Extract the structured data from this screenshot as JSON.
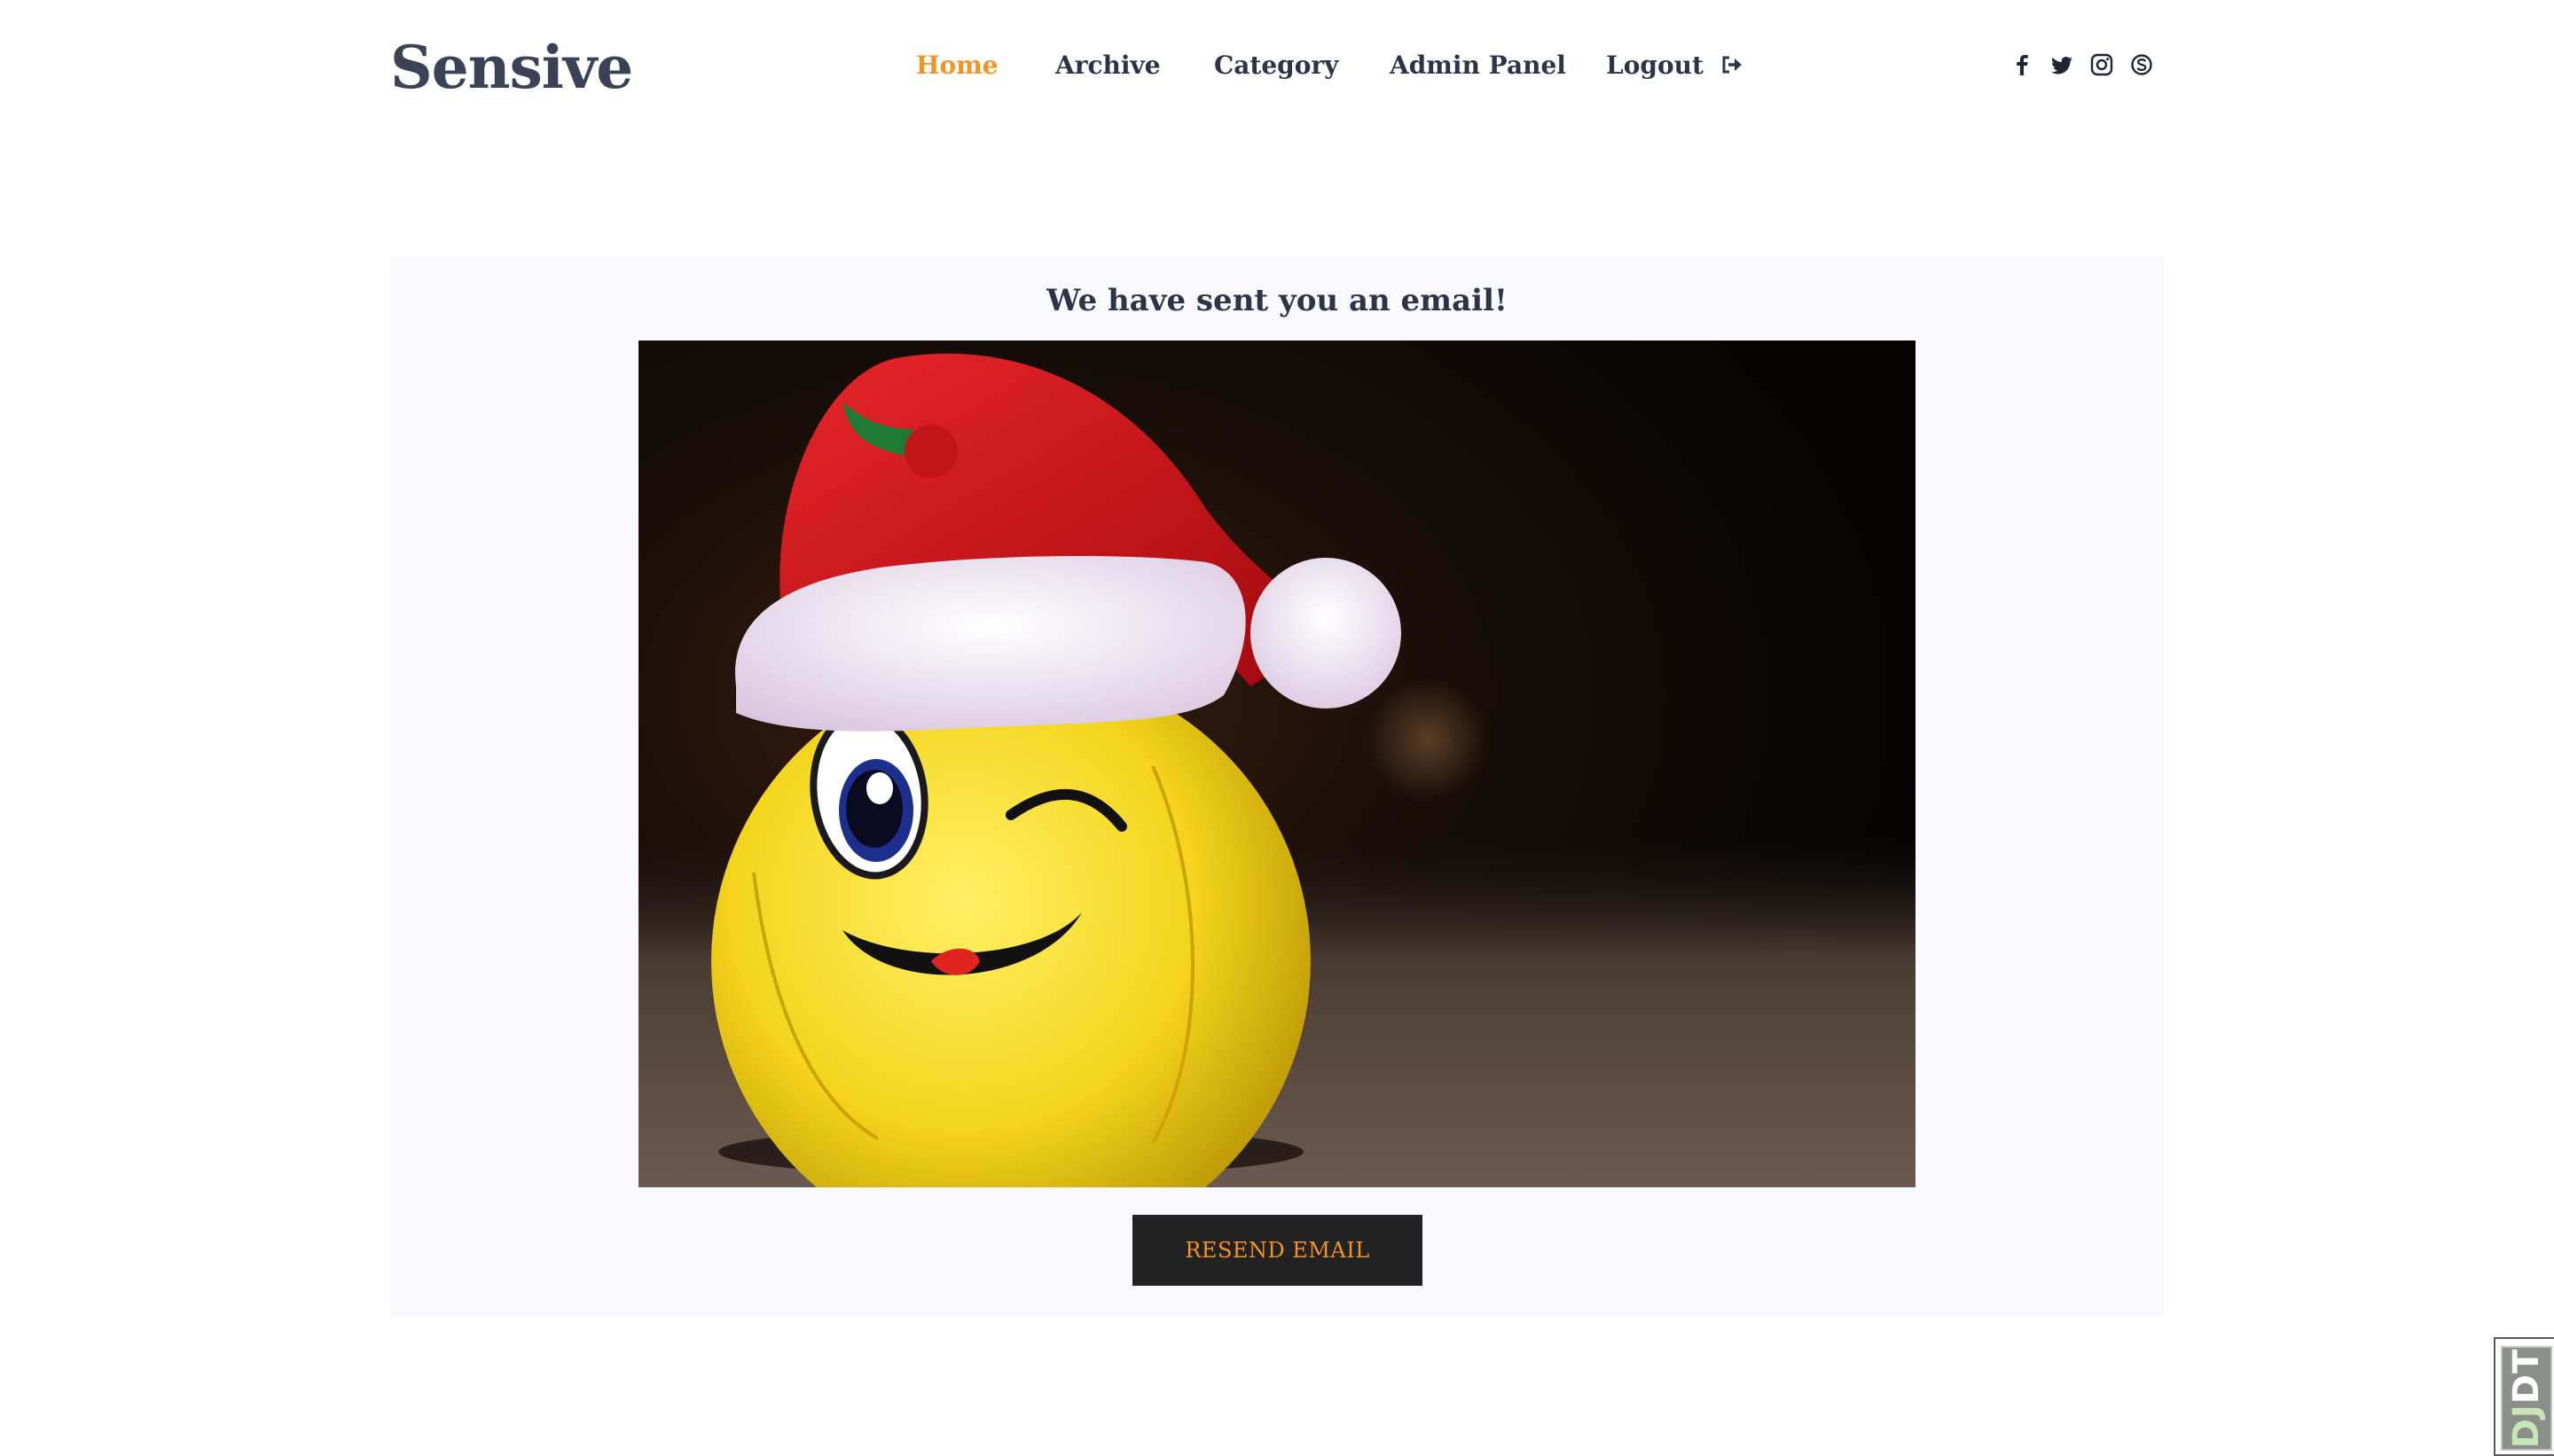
{
  "brand": {
    "logo_text": "Sensive"
  },
  "nav": {
    "items": [
      {
        "label": "Home",
        "active": true
      },
      {
        "label": "Archive",
        "active": false
      },
      {
        "label": "Category",
        "active": false
      },
      {
        "label": "Admin Panel",
        "active": false
      },
      {
        "label": "Logout",
        "active": false,
        "icon": "logout-icon"
      }
    ]
  },
  "social": {
    "icons": [
      "facebook-icon",
      "twitter-icon",
      "instagram-icon",
      "skype-icon"
    ]
  },
  "main": {
    "title": "We have sent you an email!",
    "image_subject": "winking yellow smiley plush toy wearing a red Santa hat",
    "resend_button_label": "RESEND EMAIL"
  },
  "debug_toolbar": {
    "label_dj": "DJ",
    "label_dt": "DT"
  },
  "colors": {
    "accent": "#f29424",
    "text_dark": "#2d3446",
    "card_bg": "#f9f9fd",
    "button_bg": "#222222"
  }
}
